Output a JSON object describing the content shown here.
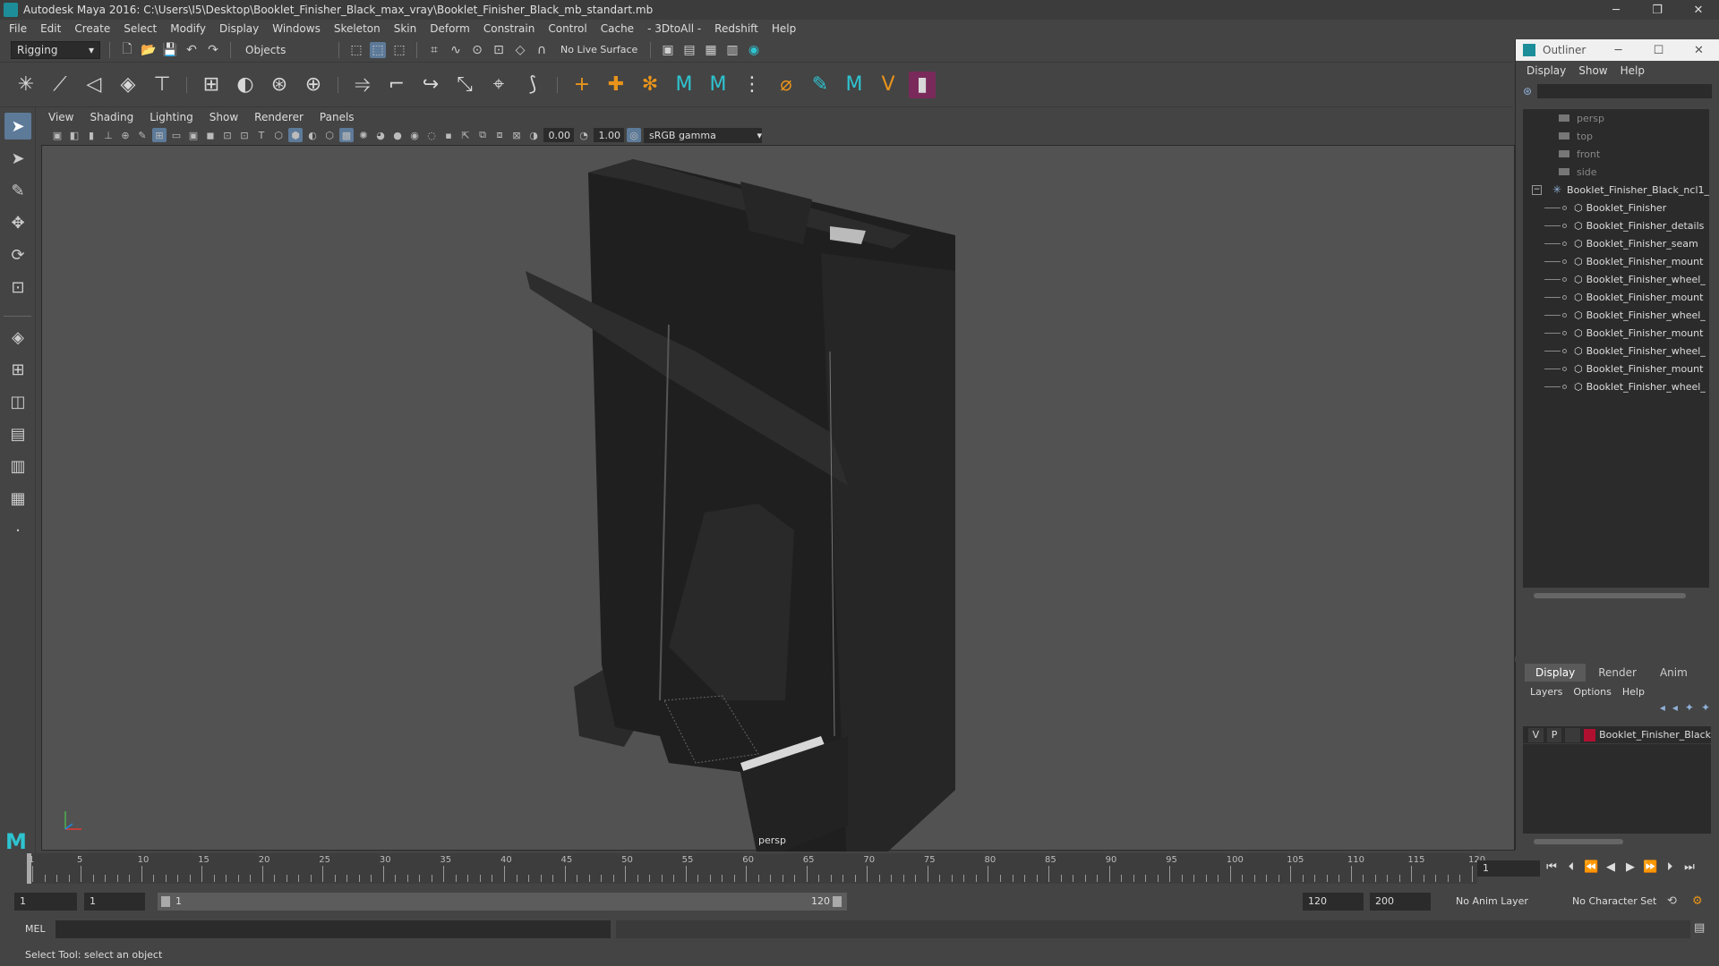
{
  "window": {
    "title": "Autodesk Maya 2016: C:\\Users\\I5\\Desktop\\Booklet_Finisher_Black_max_vray\\Booklet_Finisher_Black_mb_standart.mb",
    "minimize": "─",
    "restore": "❐",
    "close": "✕"
  },
  "menubar": [
    "File",
    "Edit",
    "Create",
    "Select",
    "Modify",
    "Display",
    "Windows",
    "Skeleton",
    "Skin",
    "Deform",
    "Constrain",
    "Control",
    "Cache",
    "- 3DtoAll -",
    "Redshift",
    "Help"
  ],
  "statusline": {
    "menu_set": "Rigging",
    "selection_mode": "Objects",
    "live_surface": "No Live Surface"
  },
  "panel": {
    "menus": [
      "View",
      "Shading",
      "Lighting",
      "Show",
      "Renderer",
      "Panels"
    ],
    "exposure": "0.00",
    "gamma": "1.00",
    "color_space": "sRGB gamma",
    "camera_label": "persp"
  },
  "outliner": {
    "title": "Outliner",
    "menus": [
      "Display",
      "Show",
      "Help"
    ],
    "cameras": [
      "persp",
      "top",
      "front",
      "side"
    ],
    "group": "Booklet_Finisher_Black_ncl1_",
    "children": [
      "Booklet_Finisher",
      "Booklet_Finisher_details",
      "Booklet_Finisher_seam",
      "Booklet_Finisher_mount",
      "Booklet_Finisher_wheel_",
      "Booklet_Finisher_mount",
      "Booklet_Finisher_wheel_",
      "Booklet_Finisher_mount",
      "Booklet_Finisher_wheel_",
      "Booklet_Finisher_mount",
      "Booklet_Finisher_wheel_"
    ]
  },
  "layers": {
    "tabs": [
      "Display",
      "Render",
      "Anim"
    ],
    "menus": [
      "Layers",
      "Options",
      "Help"
    ],
    "row": {
      "v": "V",
      "p": "P",
      "name": "Booklet_Finisher_Black",
      "color": "#b01030"
    }
  },
  "timeline": {
    "ticks": [
      "1",
      "5",
      "10",
      "15",
      "20",
      "25",
      "30",
      "35",
      "40",
      "45",
      "50",
      "55",
      "60",
      "65",
      "70",
      "75",
      "80",
      "85",
      "90",
      "95",
      "100",
      "105",
      "110",
      "115",
      "120"
    ],
    "current_frame": "1"
  },
  "range": {
    "start": "1",
    "start_inner": "1",
    "bar_start": "1",
    "bar_end": "120",
    "end_inner": "120",
    "end": "200",
    "anim_layer": "No Anim Layer",
    "character_set": "No Character Set"
  },
  "cmd": {
    "label": "MEL"
  },
  "help": {
    "text": "Select Tool: select an object"
  }
}
